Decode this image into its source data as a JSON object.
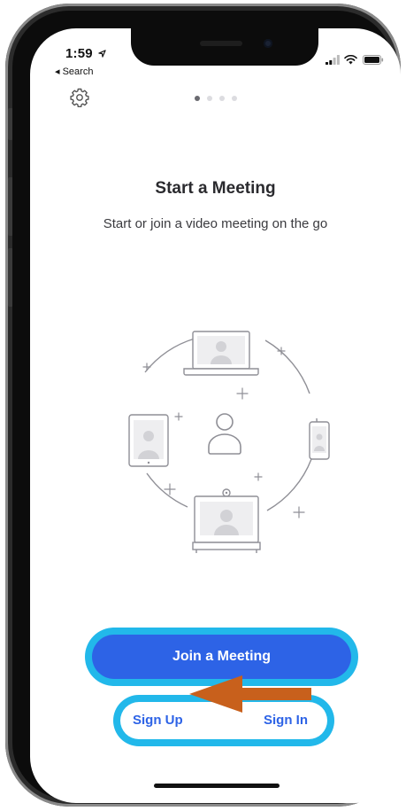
{
  "status_bar": {
    "time": "1:59",
    "back_label": "◂ Search"
  },
  "icons": {
    "settings": "gear-icon",
    "signal": "signal-icon",
    "wifi": "wifi-icon",
    "battery": "battery-icon",
    "location": "location-arrow-icon"
  },
  "pager": {
    "active_page": 1,
    "total_pages": 4
  },
  "main": {
    "title": "Start a Meeting",
    "subtitle": "Start or join a video meeting on the go"
  },
  "actions": {
    "join_label": "Join a Meeting",
    "signup_label": "Sign Up",
    "signin_label": "Sign In"
  },
  "colors": {
    "primary_blue": "#2d63e6",
    "highlight_cyan": "#22b8ea",
    "arrow_orange": "#c8601c",
    "illustration_gray": "#8f8f96"
  }
}
